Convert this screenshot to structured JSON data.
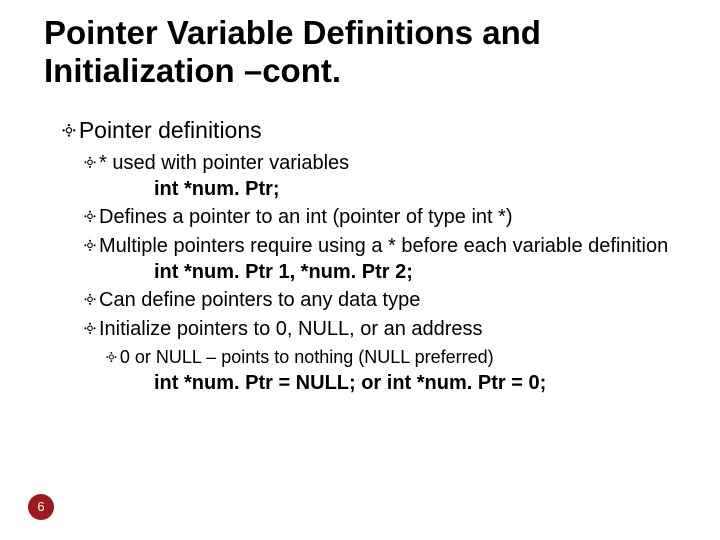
{
  "glyph": "༓",
  "title": "Pointer Variable Definitions and Initialization –cont.",
  "bullets": {
    "b1": "Pointer definitions",
    "b2": "* used with pointer variables",
    "code1": "int *num. Ptr;",
    "b3": "Defines a pointer to an int (pointer of type int *)",
    "b4": "Multiple pointers require using a * before each variable definition",
    "code2": "int *num. Ptr 1, *num. Ptr 2;",
    "b5": "Can define pointers to any data type",
    "b6": "Initialize pointers to 0, NULL, or an address",
    "b7": "0 or NULL – points to nothing (NULL preferred)",
    "code3": "int *num. Ptr =  NULL; or int *num. Ptr = 0;"
  },
  "page_number": "6"
}
